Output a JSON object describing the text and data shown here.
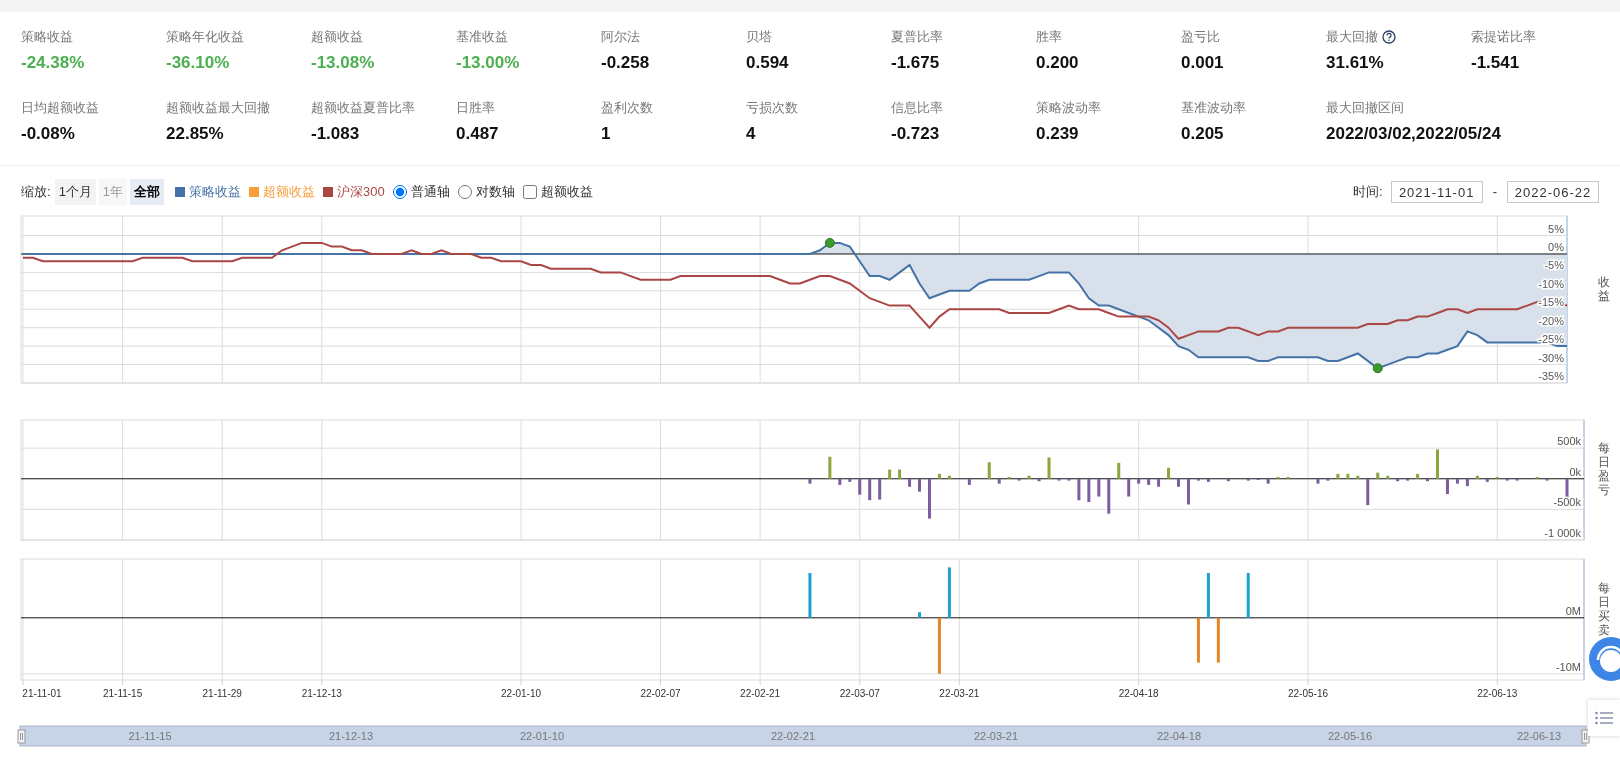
{
  "stat_rows": [
    {
      "items": [
        {
          "label": "策略收益",
          "value": "-24.38%",
          "color": "#4caf50",
          "help": false
        },
        {
          "label": "策略年化收益",
          "value": "-36.10%",
          "color": "#4caf50",
          "help": false
        },
        {
          "label": "超额收益",
          "value": "-13.08%",
          "color": "#4caf50",
          "help": false
        },
        {
          "label": "基准收益",
          "value": "-13.00%",
          "color": "#4caf50",
          "help": false
        },
        {
          "label": "阿尔法",
          "value": "-0.258",
          "color": "#111111",
          "help": false
        },
        {
          "label": "贝塔",
          "value": "0.594",
          "color": "#111111",
          "help": false
        },
        {
          "label": "夏普比率",
          "value": "-1.675",
          "color": "#111111",
          "help": false
        },
        {
          "label": "胜率",
          "value": "0.200",
          "color": "#111111",
          "help": false
        },
        {
          "label": "盈亏比",
          "value": "0.001",
          "color": "#111111",
          "help": false
        },
        {
          "label": "最大回撤",
          "value": "31.61%",
          "color": "#111111",
          "help": true
        },
        {
          "label": "索提诺比率",
          "value": "-1.541",
          "color": "#111111",
          "help": false
        }
      ]
    },
    {
      "items": [
        {
          "label": "日均超额收益",
          "value": "-0.08%",
          "color": "#111111",
          "help": false
        },
        {
          "label": "超额收益最大回撤",
          "value": "22.85%",
          "color": "#111111",
          "help": false
        },
        {
          "label": "超额收益夏普比率",
          "value": "-1.083",
          "color": "#111111",
          "help": false
        },
        {
          "label": "日胜率",
          "value": "0.487",
          "color": "#111111",
          "help": false
        },
        {
          "label": "盈利次数",
          "value": "1",
          "color": "#111111",
          "help": false
        },
        {
          "label": "亏损次数",
          "value": "4",
          "color": "#111111",
          "help": false
        },
        {
          "label": "信息比率",
          "value": "-0.723",
          "color": "#111111",
          "help": false
        },
        {
          "label": "策略波动率",
          "value": "0.239",
          "color": "#111111",
          "help": false
        },
        {
          "label": "基准波动率",
          "value": "0.205",
          "color": "#111111",
          "help": false
        },
        {
          "label": "最大回撤区间",
          "value": "2022/03/02,2022/05/24",
          "color": "#111111",
          "help": false
        }
      ]
    }
  ],
  "toolbar": {
    "zoom_label": "缩放:",
    "zoom_buttons": [
      {
        "label": "1个月",
        "selected": false,
        "disabled": false
      },
      {
        "label": "1年",
        "selected": false,
        "disabled": true
      },
      {
        "label": "全部",
        "selected": true,
        "disabled": false
      }
    ],
    "legend": [
      {
        "label": "策略收益",
        "color": "#4572a7"
      },
      {
        "label": "超额收益",
        "color": "#f79d3b"
      },
      {
        "label": "沪深300",
        "color": "#aa4643"
      }
    ],
    "axis_options": [
      {
        "label": "普通轴",
        "selected": true
      },
      {
        "label": "对数轴",
        "selected": false
      }
    ],
    "excess_checkbox": {
      "label": "超额收益",
      "checked": false
    },
    "time_label": "时间:",
    "start_date": "2021-11-01",
    "separator": "-",
    "end_date": "2022-06-22"
  },
  "charts": [
    {
      "chart_data": {
        "type": "line",
        "grid": true,
        "ylabel": "收益",
        "ylim": [
          -35,
          10.3
        ],
        "yticks": [
          {
            "value": 5,
            "label": "5%"
          },
          {
            "value": 0,
            "label": "0%"
          },
          {
            "value": -5,
            "label": "-5%"
          },
          {
            "value": -10,
            "label": "-10%"
          },
          {
            "value": -15,
            "label": "-15%"
          },
          {
            "value": -20,
            "label": "-20%"
          },
          {
            "value": -25,
            "label": "-25%"
          },
          {
            "value": -30,
            "label": "-30%"
          },
          {
            "value": -35,
            "label": "-35%"
          }
        ],
        "categories": [
          null,
          null,
          null,
          null,
          null,
          null,
          null,
          null,
          null,
          null,
          null,
          null,
          null,
          null,
          null,
          null,
          null,
          null,
          null,
          null,
          null,
          null,
          null,
          null,
          null,
          null,
          null,
          null,
          null,
          null,
          null,
          null,
          null,
          null,
          null,
          null,
          null,
          null,
          null,
          null,
          null,
          null,
          null,
          null,
          null,
          null,
          null,
          null,
          null,
          null,
          null,
          null,
          null,
          null,
          null,
          null,
          null,
          null,
          null,
          null,
          null,
          null,
          null,
          null,
          null,
          null,
          null,
          null,
          null,
          null,
          null,
          null,
          null,
          null,
          null,
          null,
          null,
          null,
          null,
          null,
          null,
          null,
          null,
          null,
          null,
          null,
          null,
          null,
          null,
          null,
          null,
          null,
          null,
          null,
          null,
          null,
          null,
          null,
          null,
          null,
          null,
          null,
          null,
          null,
          null,
          null,
          null,
          null,
          null,
          null,
          null,
          null,
          null,
          null,
          null,
          null,
          null,
          null,
          null,
          null,
          null,
          null,
          null,
          null,
          null,
          null,
          null,
          null,
          null,
          null,
          null,
          null,
          null,
          null,
          null,
          null,
          null,
          null,
          null,
          null,
          null,
          null,
          null,
          null,
          null,
          null,
          null,
          null,
          null,
          null,
          null,
          null,
          null,
          null,
          null,
          null
        ],
        "series": [
          {
            "color": "#4572a7",
            "values": [
              0,
              0,
              0,
              0,
              0,
              0,
              0,
              0,
              0,
              0,
              0,
              0,
              0,
              0,
              0,
              0,
              0,
              0,
              0,
              0,
              0,
              0,
              0,
              0,
              0,
              0,
              0,
              0,
              0,
              0,
              0,
              0,
              0,
              0,
              0,
              0,
              0,
              0,
              0,
              0,
              0,
              0,
              0,
              0,
              0,
              0,
              0,
              0,
              0,
              0,
              0,
              0,
              0,
              0,
              0,
              0,
              0,
              0,
              0,
              0,
              0,
              0,
              0,
              0,
              0,
              0,
              0,
              0,
              0,
              0,
              0,
              0,
              0,
              0,
              0,
              0,
              0,
              0,
              0,
              0,
              1,
              3,
              3,
              2,
              -2,
              -6,
              -6,
              -7,
              -5,
              -3,
              -8,
              -12,
              -11,
              -10,
              -10,
              -10,
              -8,
              -7,
              -7,
              -7,
              -7,
              -7,
              -6,
              -5,
              -5,
              -5,
              -8,
              -12,
              -14,
              -14,
              -15,
              -16,
              -17,
              -18,
              -20,
              -22,
              -25,
              -26,
              -28,
              -28,
              -28,
              -28,
              -28,
              -28,
              -29,
              -29,
              -28,
              -28,
              -28,
              -28,
              -28,
              -29,
              -29,
              -28,
              -27,
              -29,
              -31,
              -30,
              -29,
              -28,
              -28,
              -27,
              -27,
              -26,
              -25,
              -21,
              -22,
              -24,
              -24,
              -24,
              -24,
              -24,
              -24,
              -24,
              -25,
              -25
            ]
          },
          {
            "color": "#aa4643",
            "values": [
              -1,
              -1,
              -2,
              -2,
              -2,
              -2,
              -2,
              -2,
              -2,
              -2,
              -2,
              -2,
              -1,
              -1,
              -1,
              -1,
              -1,
              -2,
              -2,
              -2,
              -2,
              -2,
              -1,
              -1,
              -1,
              -1,
              1,
              2,
              3,
              3,
              3,
              2,
              2,
              1,
              1,
              0,
              0,
              0,
              0,
              1,
              0,
              0,
              1,
              0,
              0,
              0,
              -1,
              -1,
              -2,
              -2,
              -2,
              -3,
              -3,
              -4,
              -4,
              -4,
              -4,
              -4,
              -5,
              -5,
              -5,
              -6,
              -7,
              -7,
              -7,
              -7,
              -6,
              -6,
              -6,
              -6,
              -6,
              -6,
              -6,
              -6,
              -6,
              -6,
              -7,
              -8,
              -8,
              -7,
              -6,
              -6,
              -7,
              -8,
              -10,
              -12,
              -13,
              -14,
              -14,
              -14,
              -17,
              -20,
              -17,
              -15,
              -15,
              -15,
              -15,
              -15,
              -15,
              -16,
              -16,
              -16,
              -16,
              -16,
              -15,
              -14,
              -15,
              -15,
              -15,
              -16,
              -17,
              -17,
              -17,
              -17,
              -18,
              -20,
              -23,
              -22,
              -21,
              -21,
              -21,
              -20,
              -20,
              -21,
              -22,
              -21,
              -21,
              -20,
              -20,
              -20,
              -20,
              -20,
              -20,
              -20,
              -20,
              -19,
              -19,
              -19,
              -18,
              -18,
              -17,
              -17,
              -16,
              -15,
              -15,
              -16,
              -15,
              -15,
              -15,
              -15,
              -15,
              -14,
              -13,
              -13,
              -13,
              -14
            ]
          }
        ]
      }
    },
    {
      "chart_data": {
        "type": "bar",
        "grid": true,
        "ylabel": "每日盈亏",
        "ylim": [
          -1000,
          960
        ],
        "yticks": [
          {
            "value": 500,
            "label": "500k"
          },
          {
            "value": 0,
            "label": "0k"
          },
          {
            "value": -500,
            "label": "-500k"
          },
          {
            "value": -1000,
            "label": "-1 000k"
          }
        ],
        "categories": [
          null,
          null,
          null,
          null,
          null,
          null,
          null,
          null,
          null,
          null,
          null,
          null,
          null,
          null,
          null,
          null,
          null,
          null,
          null,
          null,
          null,
          null,
          null,
          null,
          null,
          null,
          null,
          null,
          null,
          null,
          null,
          null,
          null,
          null,
          null,
          null,
          null,
          null,
          null,
          null,
          null,
          null,
          null,
          null,
          null,
          null,
          null,
          null,
          null,
          null,
          null,
          null,
          null,
          null,
          null,
          null,
          null,
          null,
          null,
          null,
          null,
          null,
          null,
          null,
          null,
          null,
          null,
          null,
          null,
          null,
          null,
          null,
          null,
          null,
          null,
          null,
          null,
          null,
          null,
          null,
          null,
          null,
          null,
          null,
          null,
          null,
          null,
          null,
          null,
          null,
          null,
          null,
          null,
          null,
          null,
          null,
          null,
          null,
          null,
          null,
          null,
          null,
          null,
          null,
          null,
          null,
          null,
          null,
          null,
          null,
          null,
          null,
          null,
          null,
          null,
          null,
          null,
          null,
          null,
          null,
          null,
          null,
          null,
          null,
          null,
          null,
          null,
          null,
          null,
          null,
          null,
          null,
          null,
          null,
          null,
          null,
          null,
          null,
          null,
          null,
          null,
          null,
          null,
          null,
          null,
          null,
          null,
          null,
          null,
          null,
          null,
          null,
          null,
          null,
          null,
          null
        ],
        "series": [
          {
            "color": "#8aa63c",
            "values": [
              null,
              null,
              null,
              null,
              null,
              null,
              null,
              null,
              null,
              null,
              null,
              null,
              null,
              null,
              null,
              null,
              null,
              null,
              null,
              null,
              null,
              null,
              null,
              null,
              null,
              null,
              null,
              null,
              null,
              null,
              null,
              null,
              null,
              null,
              null,
              null,
              null,
              null,
              null,
              null,
              null,
              null,
              null,
              null,
              null,
              null,
              null,
              null,
              null,
              null,
              null,
              null,
              null,
              null,
              null,
              null,
              null,
              null,
              null,
              null,
              null,
              null,
              null,
              null,
              null,
              null,
              null,
              null,
              null,
              null,
              null,
              null,
              null,
              null,
              null,
              null,
              null,
              null,
              null,
              null,
              null,
              360,
              null,
              null,
              null,
              null,
              null,
              150,
              150,
              null,
              null,
              null,
              80,
              50,
              null,
              null,
              null,
              270,
              null,
              30,
              null,
              50,
              null,
              350,
              null,
              null,
              null,
              null,
              null,
              null,
              260,
              null,
              null,
              null,
              null,
              180,
              null,
              null,
              null,
              null,
              null,
              null,
              null,
              null,
              null,
              null,
              30,
              30,
              null,
              null,
              null,
              null,
              80,
              80,
              50,
              null,
              100,
              50,
              null,
              null,
              80,
              null,
              480,
              null,
              null,
              null,
              50,
              null,
              30,
              null,
              null,
              null,
              30,
              null,
              null,
              null
            ]
          },
          {
            "color": "#7b5e9f",
            "values": [
              null,
              null,
              null,
              null,
              null,
              null,
              null,
              null,
              null,
              null,
              null,
              null,
              null,
              null,
              null,
              null,
              null,
              null,
              null,
              null,
              null,
              null,
              null,
              null,
              null,
              null,
              null,
              null,
              null,
              null,
              null,
              null,
              null,
              null,
              null,
              null,
              null,
              null,
              null,
              null,
              null,
              null,
              null,
              null,
              null,
              null,
              null,
              null,
              null,
              null,
              null,
              null,
              null,
              null,
              null,
              null,
              null,
              null,
              null,
              null,
              null,
              null,
              null,
              null,
              null,
              null,
              null,
              null,
              null,
              null,
              null,
              null,
              null,
              null,
              null,
              null,
              null,
              null,
              null,
              -80,
              null,
              null,
              -100,
              -50,
              -260,
              -350,
              -340,
              null,
              null,
              -130,
              -210,
              -650,
              null,
              null,
              null,
              -100,
              null,
              null,
              -80,
              null,
              -30,
              null,
              -40,
              null,
              -30,
              -30,
              -350,
              -380,
              -290,
              -570,
              null,
              -290,
              -80,
              -100,
              -130,
              null,
              -130,
              -420,
              -30,
              -50,
              null,
              -40,
              null,
              -30,
              -20,
              -80,
              null,
              null,
              null,
              null,
              -80,
              -30,
              null,
              null,
              null,
              -430,
              null,
              null,
              -40,
              -30,
              null,
              -40,
              null,
              -250,
              -80,
              -120,
              null,
              -50,
              null,
              -30,
              -30,
              null,
              null,
              -30,
              null,
              -340
            ]
          }
        ]
      }
    },
    {
      "chart_data": {
        "type": "bar",
        "grid": true,
        "ylabel": "每日买卖",
        "ylim": [
          -11.1,
          10.5
        ],
        "yticks": [
          {
            "value": 0,
            "label": "0M"
          },
          {
            "value": -10,
            "label": "-10M"
          }
        ],
        "categories": [
          "21-11-01",
          null,
          null,
          null,
          null,
          null,
          null,
          null,
          null,
          null,
          "21-11-15",
          null,
          null,
          null,
          null,
          null,
          null,
          null,
          null,
          null,
          "21-11-29",
          null,
          null,
          null,
          null,
          null,
          null,
          null,
          null,
          null,
          "21-12-13",
          null,
          null,
          null,
          null,
          null,
          null,
          null,
          null,
          null,
          null,
          null,
          null,
          null,
          null,
          null,
          null,
          null,
          null,
          null,
          "22-01-10",
          null,
          null,
          null,
          null,
          null,
          null,
          null,
          null,
          null,
          null,
          null,
          null,
          null,
          "22-02-07",
          null,
          null,
          null,
          null,
          null,
          null,
          null,
          null,
          null,
          "22-02-21",
          null,
          null,
          null,
          null,
          null,
          null,
          null,
          null,
          null,
          "22-03-07",
          null,
          null,
          null,
          null,
          null,
          null,
          null,
          null,
          null,
          "22-03-21",
          null,
          null,
          null,
          null,
          null,
          null,
          null,
          null,
          null,
          null,
          null,
          null,
          null,
          null,
          null,
          null,
          null,
          "22-04-18",
          null,
          null,
          null,
          null,
          null,
          null,
          null,
          null,
          null,
          null,
          null,
          null,
          null,
          null,
          null,
          null,
          "22-05-16",
          null,
          null,
          null,
          null,
          null,
          null,
          null,
          null,
          null,
          null,
          null,
          null,
          null,
          null,
          null,
          null,
          null,
          null,
          "22-06-13",
          null,
          null,
          null,
          null,
          null,
          null,
          null
        ],
        "series": [
          {
            "color": "#1ea1cf",
            "values": [
              null,
              null,
              null,
              null,
              null,
              null,
              null,
              null,
              null,
              null,
              null,
              null,
              null,
              null,
              null,
              null,
              null,
              null,
              null,
              null,
              null,
              null,
              null,
              null,
              null,
              null,
              null,
              null,
              null,
              null,
              null,
              null,
              null,
              null,
              null,
              null,
              null,
              null,
              null,
              null,
              null,
              null,
              null,
              null,
              null,
              null,
              null,
              null,
              null,
              null,
              null,
              null,
              null,
              null,
              null,
              null,
              null,
              null,
              null,
              null,
              null,
              null,
              null,
              null,
              null,
              null,
              null,
              null,
              null,
              null,
              null,
              null,
              null,
              null,
              null,
              null,
              null,
              null,
              null,
              8,
              null,
              null,
              null,
              null,
              null,
              null,
              null,
              null,
              null,
              null,
              1,
              null,
              null,
              9,
              null,
              null,
              null,
              null,
              null,
              null,
              null,
              null,
              null,
              null,
              null,
              null,
              null,
              null,
              null,
              null,
              null,
              null,
              null,
              null,
              null,
              null,
              null,
              null,
              null,
              8,
              null,
              null,
              null,
              8,
              null,
              null,
              null,
              null,
              null,
              null,
              null,
              null,
              null,
              null,
              null,
              null,
              null,
              null,
              null,
              null,
              null,
              null,
              null,
              null,
              null,
              null,
              null,
              null,
              null,
              null,
              null,
              null,
              null,
              null,
              null,
              null
            ]
          },
          {
            "color": "#e8852a",
            "values": [
              null,
              null,
              null,
              null,
              null,
              null,
              null,
              null,
              null,
              null,
              null,
              null,
              null,
              null,
              null,
              null,
              null,
              null,
              null,
              null,
              null,
              null,
              null,
              null,
              null,
              null,
              null,
              null,
              null,
              null,
              null,
              null,
              null,
              null,
              null,
              null,
              null,
              null,
              null,
              null,
              null,
              null,
              null,
              null,
              null,
              null,
              null,
              null,
              null,
              null,
              null,
              null,
              null,
              null,
              null,
              null,
              null,
              null,
              null,
              null,
              null,
              null,
              null,
              null,
              null,
              null,
              null,
              null,
              null,
              null,
              null,
              null,
              null,
              null,
              null,
              null,
              null,
              null,
              null,
              null,
              null,
              null,
              null,
              null,
              null,
              null,
              null,
              null,
              null,
              null,
              null,
              null,
              -10,
              null,
              null,
              null,
              null,
              null,
              null,
              null,
              null,
              null,
              null,
              null,
              null,
              null,
              null,
              null,
              null,
              null,
              null,
              null,
              null,
              null,
              null,
              null,
              null,
              null,
              -8,
              null,
              -8,
              null,
              null,
              null,
              null,
              null,
              null,
              null,
              null,
              null,
              null,
              null,
              null,
              null,
              null,
              null,
              null,
              null,
              null,
              null,
              null,
              null,
              null,
              null,
              null,
              null,
              null,
              null,
              null,
              null,
              null,
              null,
              null,
              null,
              null,
              null
            ]
          }
        ]
      }
    }
  ],
  "navigator": {
    "labels": [
      "21-11-15",
      "21-12-13",
      "22-01-10",
      "22-02-21",
      "22-03-21",
      "22-04-18",
      "22-05-16",
      "22-06-13"
    ]
  }
}
